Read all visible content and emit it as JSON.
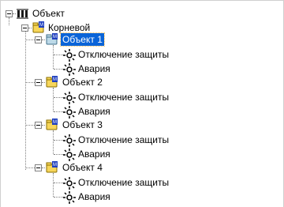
{
  "tree": {
    "root_label": "Объект",
    "root_icon": "object-root-icon",
    "child_label": "Корневой",
    "child_icon": "folder-object-icon",
    "objects": [
      {
        "label": "Объект 1",
        "selected": true,
        "children": [
          "Отключение защиты",
          "Авария"
        ]
      },
      {
        "label": "Объект 2",
        "selected": false,
        "children": [
          "Отключение защиты",
          "Авария"
        ]
      },
      {
        "label": "Объект 3",
        "selected": false,
        "children": [
          "Отключение защиты",
          "Авария"
        ]
      },
      {
        "label": "Объект 4",
        "selected": false,
        "children": [
          "Отключение защиты",
          "Авария"
        ]
      }
    ],
    "selection_color": "#0a64d8"
  }
}
